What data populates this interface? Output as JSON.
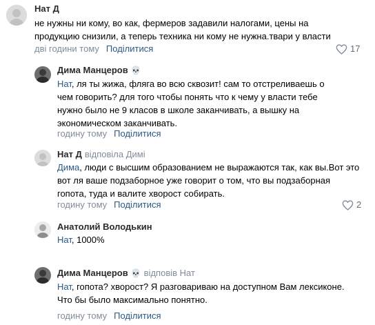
{
  "comments": [
    {
      "author": "Нат Д",
      "text": "не нужны ни кому, во как, фермеров задавили налогами, цены на продукцию снизили, а теперь техника ни кому не нужна.твари у власти",
      "time": "дві години тому",
      "share_label": "Поділитися",
      "likes": "17"
    },
    {
      "author": "Дима Манцеров",
      "author_suffix": "💀",
      "mention": "Нат",
      "text": ", ля ты жижа, фляга во всю сквозит! сам то отстреливаешь о чем говорить? для того чтобы понять что к чему у власти тебе нужно было не 9 класов в школе заканчивать, а вышку на экономическом заканчивать.",
      "time": "годину тому",
      "share_label": "Поділитися"
    },
    {
      "author": "Нат Д",
      "replied_to": "відповіла Димі",
      "mention": "Дима",
      "text": ", люди с высшим образованием не выражаются так, как вы.Вот это вот ля ваше подзаборное уже говорит о том, что вы подзаборная гопота, туда и валите хворост собирать.",
      "time": "годину тому",
      "share_label": "Поділитися",
      "likes": "2"
    },
    {
      "author": "Анатолий Володькин",
      "mention": "Нат",
      "text": ", 1000%"
    },
    {
      "author": "Дима Манцеров",
      "author_suffix": "💀",
      "replied_to": "відповів Нат",
      "mention": "Нат",
      "text": ", гопота? хворост? Я разговариваю на доступном Вам лексиконе. Что бы было максимально понятно.",
      "time": "годину тому",
      "share_label": "Поділитися"
    }
  ],
  "icons": {
    "like": "heart-outline-icon",
    "suffix": "skull-emoji"
  },
  "colors": {
    "link": "#2a5885",
    "meta": "#818c99",
    "avatar_bg": "#d9d9d9"
  }
}
